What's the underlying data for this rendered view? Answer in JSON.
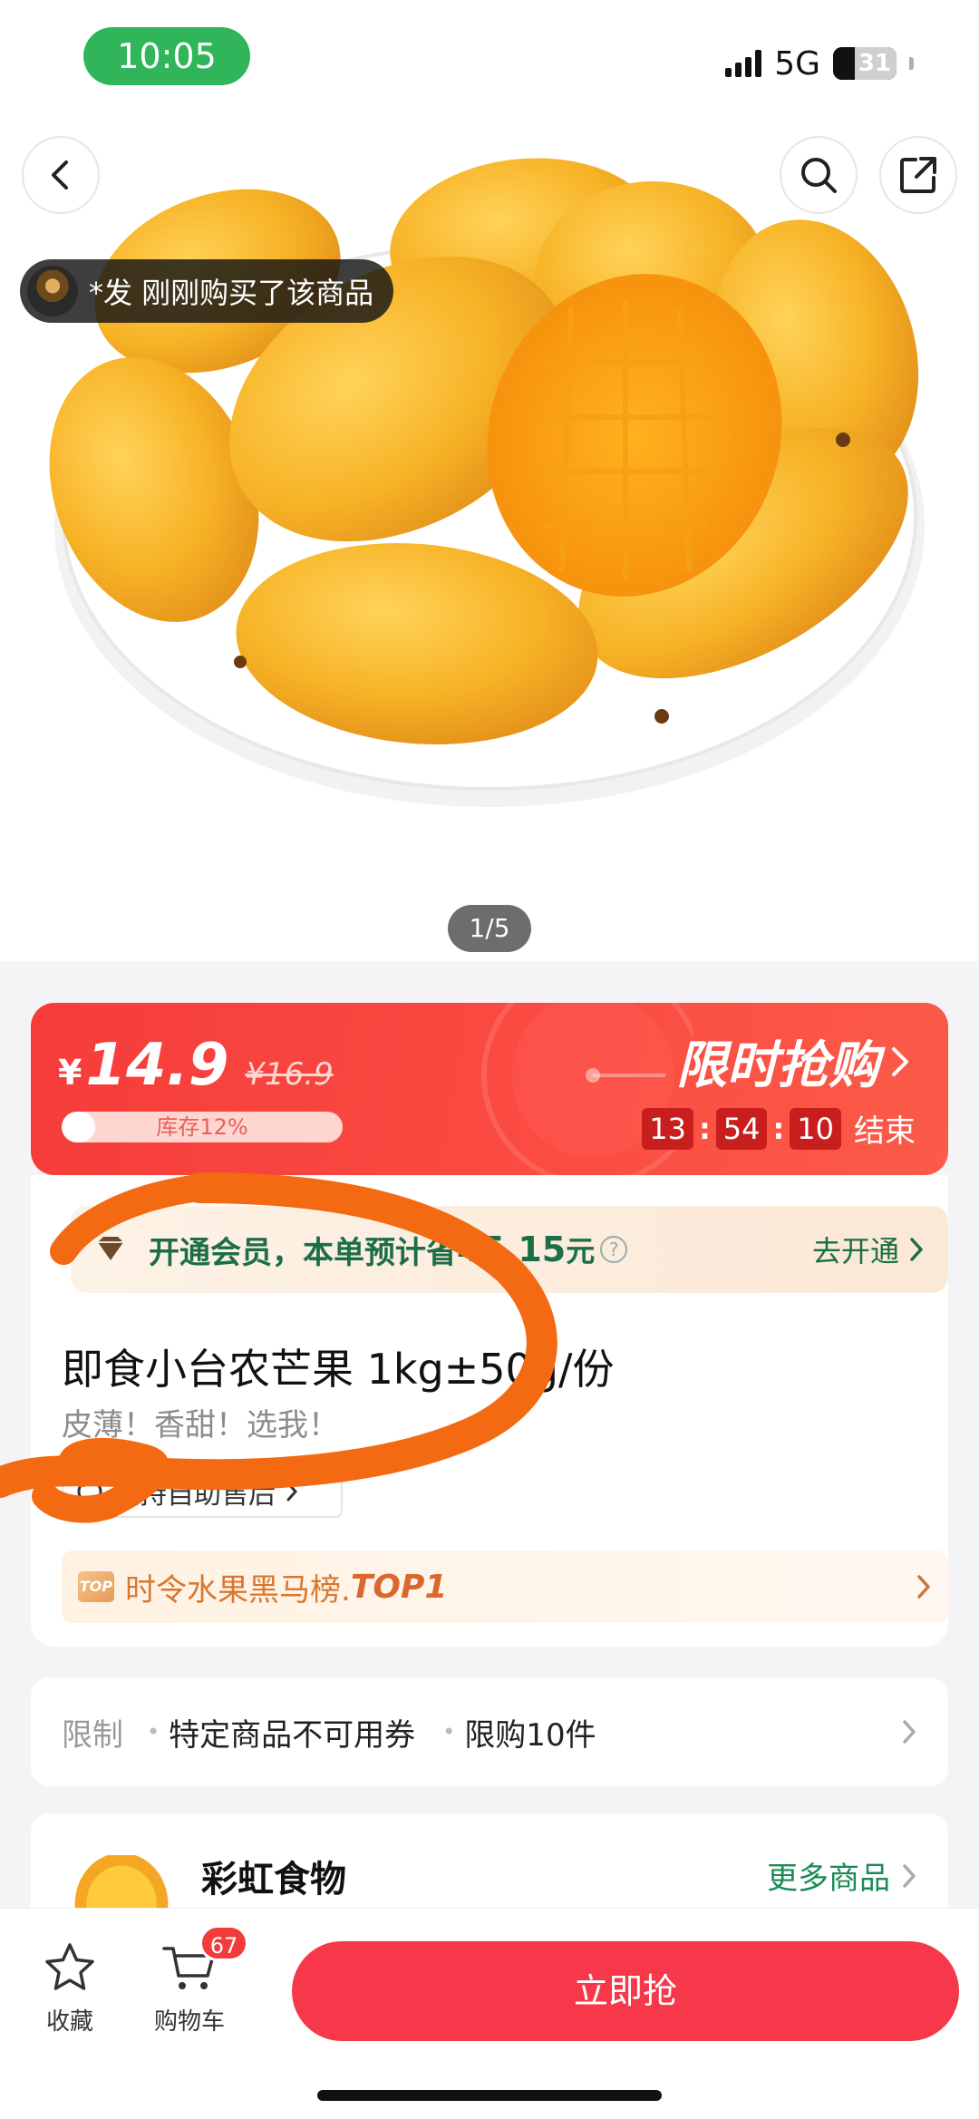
{
  "status_bar": {
    "time": "10:05",
    "network": "5G",
    "battery": "31"
  },
  "top_buttons": {
    "back_icon": "chevron-left-icon",
    "search_icon": "search-icon",
    "share_icon": "share-icon"
  },
  "buyer_toast": {
    "text": "*发 刚刚购买了该商品"
  },
  "gallery": {
    "pager": "1/5"
  },
  "price": {
    "currency": "¥",
    "current": "14.9",
    "original": "¥16.9",
    "stock_label": "库存12%",
    "stock_fraction": 0.12,
    "flash_title": "限时抢购",
    "countdown": {
      "hours": "13",
      "minutes": "54",
      "seconds": "10",
      "suffix": "结束"
    }
  },
  "membership": {
    "text": "开通会员，本单预计省",
    "amount": "45.15",
    "unit": "元",
    "cta": "去开通"
  },
  "product": {
    "title": "即食小台农芒果 1kg±50g/份",
    "subtitle": "皮薄！香甜！选我！",
    "after_sale": "支持自助售后",
    "rank_badge": "TOP",
    "rank_label": "时令水果黑马榜.",
    "rank_top": "TOP1"
  },
  "limits": {
    "label": "限制",
    "items": [
      "特定商品不可用券",
      "限购10件"
    ]
  },
  "store": {
    "name": "彩虹食物",
    "more": "更多商品"
  },
  "bottom_bar": {
    "favorite_label": "收藏",
    "cart_label": "购物车",
    "cart_count": "67",
    "buy_label": "立即抢"
  },
  "colors": {
    "accent_red": "#f53c3a",
    "buy_button": "#f7374a",
    "member_green": "#1b6e45",
    "status_green": "#30b55a",
    "annotation_orange": "#f36a12"
  }
}
